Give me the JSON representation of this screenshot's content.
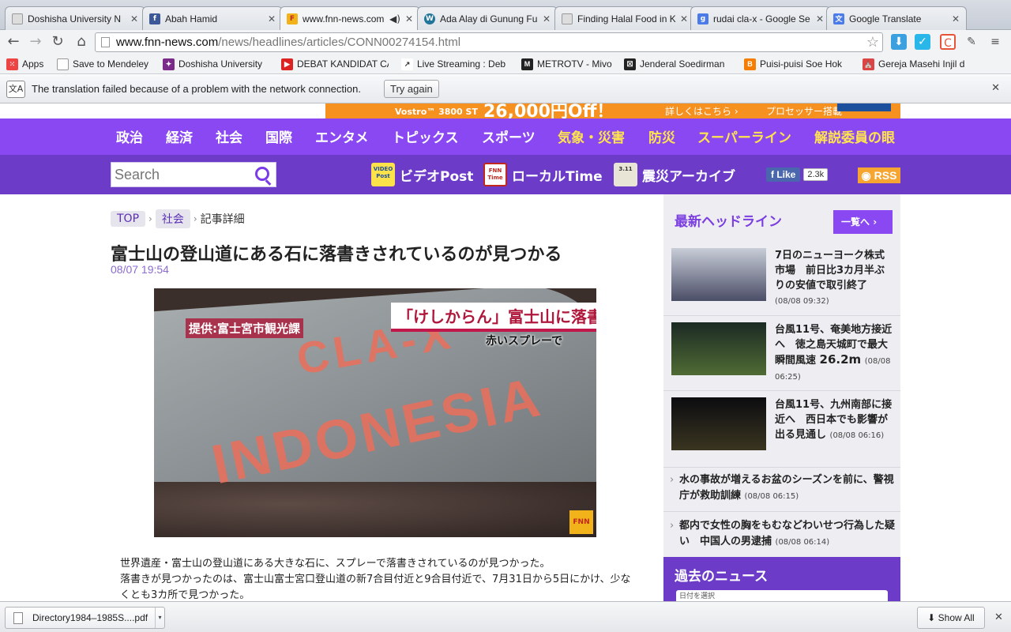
{
  "browser": {
    "tabs": [
      {
        "title": "Doshisha University N",
        "favicon": "page-icon",
        "color": "#bcbcbc",
        "active": false
      },
      {
        "title": "Abah Hamid",
        "favicon": "facebook-icon",
        "color": "#3b5998",
        "active": false
      },
      {
        "title": "www.fnn-news.com",
        "favicon": "fnn-icon",
        "color": "#f2b31a",
        "active": true
      },
      {
        "title": "Ada Alay di Gunung Fu",
        "favicon": "wordpress-icon",
        "color": "#21759b",
        "active": false
      },
      {
        "title": "Finding Halal Food in K",
        "favicon": "page-icon",
        "color": "#bcbcbc",
        "active": false
      },
      {
        "title": "rudai cla-x - Google Se",
        "favicon": "google-icon",
        "color": "#4a7be8",
        "active": false
      },
      {
        "title": "Google Translate",
        "favicon": "translate-icon",
        "color": "#4a7be8",
        "active": false
      }
    ],
    "url_host": "www.fnn-news.com",
    "url_path": "/news/headlines/articles/CONN00274154.html",
    "bookmarks": [
      {
        "label": "Apps",
        "icon": "apps-grid-icon",
        "color": "#e44"
      },
      {
        "label": "Save to Mendeley",
        "icon": "page-icon",
        "color": "#bcbcbc"
      },
      {
        "label": "Doshisha University",
        "icon": "doshisha-icon",
        "color": "#7b2a8a"
      },
      {
        "label": "DEBAT KANDIDAT CA",
        "icon": "youtube-icon",
        "color": "#d22"
      },
      {
        "label": "Live Streaming : Deb",
        "icon": "stream-icon",
        "color": "#444"
      },
      {
        "label": "METROTV - Mivo",
        "icon": "mivo-icon",
        "color": "#222"
      },
      {
        "label": "Jenderal Soedirman",
        "icon": "soedirman-icon",
        "color": "#222"
      },
      {
        "label": "Puisi-puisi Soe Hok",
        "icon": "blogger-icon",
        "color": "#f57d00"
      },
      {
        "label": "Gereja Masehi Injil d",
        "icon": "church-icon",
        "color": "#d44"
      }
    ],
    "translate_bar": {
      "message": "The translation failed because of a problem with the network connection.",
      "retry_label": "Try again"
    },
    "download": {
      "filename": "Directory1984–1985S....pdf",
      "show_all": "Show All"
    }
  },
  "site": {
    "ad": {
      "model": "Vostro™ 3800 ST",
      "price": "26,000円Off！",
      "detail": "詳しくはこちら ›",
      "cpu": "プロセッサー搭載"
    },
    "nav": [
      "政治",
      "経済",
      "社会",
      "国際",
      "エンタメ",
      "トピックス",
      "スポーツ",
      "気象・災害",
      "防災",
      "スーパーライン",
      "解説委員の眼"
    ],
    "search_placeholder": "Search",
    "subnav": [
      {
        "label": "ビデオPost",
        "icon_text": "VIDEO Post"
      },
      {
        "label": "ローカルTime",
        "icon_text": "FNN ローカル Time"
      },
      {
        "label": "震災アーカイブ",
        "icon_text": "3.11"
      }
    ],
    "fb_like": "Like",
    "fb_count": "2.3k",
    "rss": "RSS"
  },
  "article": {
    "breadcrumb": [
      "TOP",
      "社会",
      "記事詳細"
    ],
    "title": "富士山の登山道にある石に落書きされているのが見つかる",
    "timestamp": "08/07 19:54",
    "photo": {
      "credit": "提供:富士宮市観光課",
      "caption": "「けしからん」富士山に落書き",
      "subcaption": "赤いスプレーで",
      "graffiti_line1": "CLA-X",
      "graffiti_line2": "INDONESIA",
      "logo": "FNN"
    },
    "body_1": "世界遺産・富士山の登山道にある大きな石に、スプレーで落書きされているのが見つかった。",
    "body_2": "落書きが見つかったのは、富士山富士宮口登山道の新7合目付近と9合目付近で、7月31日から5日にかけ、少なくとも3カ所で見つかった。"
  },
  "sidebar": {
    "title": "最新ヘッドライン",
    "more_label": "一覧へ",
    "headlines": [
      {
        "text": "7日のニューヨーク株式市場　前日比3カ月半ぶりの安値で取引終了",
        "time": "(08/08 09:32)"
      },
      {
        "text": "台風11号、奄美地方接近へ　徳之島天城町で最大瞬間風速",
        "big": "26.2m",
        "time": "(08/08 06:25)"
      },
      {
        "text": "台風11号、九州南部に接近へ　西日本でも影響が出る見通し",
        "time": "(08/08 06:16)"
      }
    ],
    "text_items": [
      {
        "text": "水の事故が増えるお盆のシーズンを前に、警視庁が救助訓練",
        "time": "(08/08 06:15)"
      },
      {
        "text": "都内で女性の胸をもむなどわいせつ行為した疑い　中国人の男逮捕",
        "time": "(08/08 06:14)"
      }
    ],
    "past_title": "過去のニュース",
    "past_select": "日付を選択"
  }
}
